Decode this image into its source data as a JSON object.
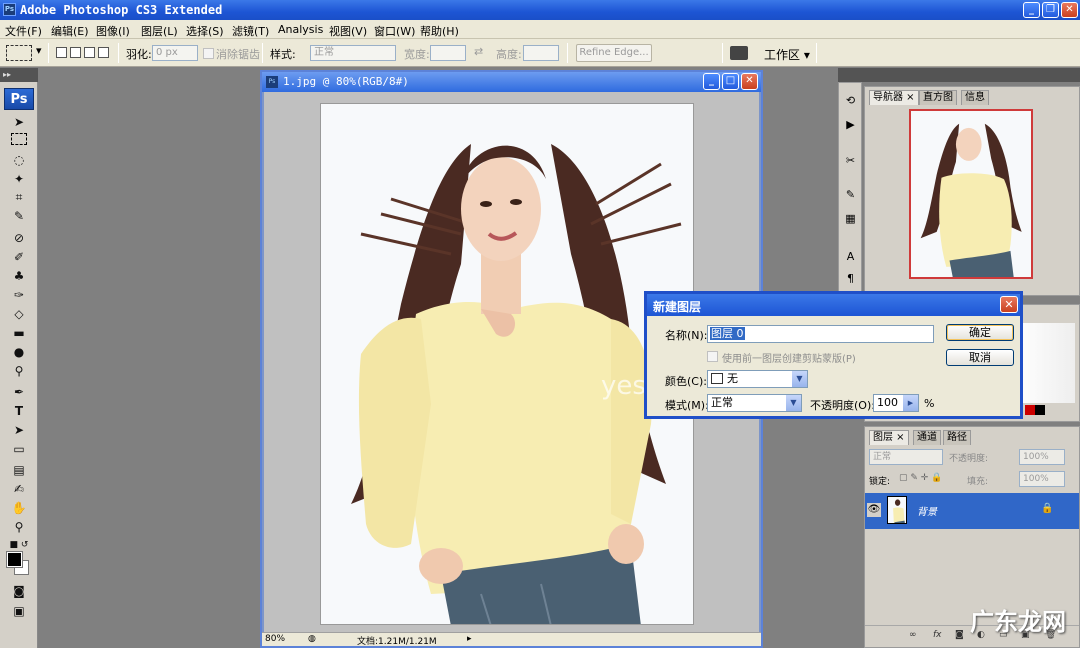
{
  "window": {
    "title": "Adobe Photoshop CS3 Extended",
    "min": "_",
    "restore": "❐",
    "close": "✕"
  },
  "menu": [
    "文件(F)",
    "编辑(E)",
    "图像(I)",
    "图层(L)",
    "选择(S)",
    "滤镜(T)",
    "Analysis",
    "视图(V)",
    "窗口(W)",
    "帮助(H)"
  ],
  "options": {
    "feather_label": "羽化:",
    "feather_value": "0 px",
    "antialias_label": "消除锯齿",
    "style_label": "样式:",
    "style_value": "正常",
    "width_label": "宽度:",
    "height_label": "高度:",
    "refine_edge": "Refine Edge...",
    "workspace": "工作区 ▾"
  },
  "document": {
    "title": "1.jpg @ 80%(RGB/8#)",
    "zoom": "80%",
    "docsize": "文档:1.21M/1.21M"
  },
  "navigator": {
    "tabs": [
      "导航器 ×",
      "直方图",
      "信息"
    ]
  },
  "layers": {
    "tabs": [
      "图层 ×",
      "通道",
      "路径"
    ],
    "blend_mode": "正常",
    "opacity_label": "不透明度:",
    "opacity_value": "100%",
    "lock_label": "锁定:",
    "fill_label": "填充:",
    "fill_value": "100%",
    "layer_name": "背景",
    "footer_icons": [
      "链接",
      "fx",
      "蒙版",
      "调整",
      "组",
      "新建",
      "删除"
    ]
  },
  "dialog": {
    "title": "新建图层",
    "name_label": "名称(N):",
    "name_value": "图层 0",
    "clip_label": "使用前一图层创建剪贴蒙版(P)",
    "color_label": "颜色(C):",
    "color_value": "无",
    "mode_label": "模式(M):",
    "mode_value": "正常",
    "opacity_label": "不透明度(O):",
    "opacity_value": "100",
    "opacity_unit": "%",
    "ok": "确定",
    "cancel": "取消"
  },
  "watermark": "广东龙网",
  "canvas_watermark": "yesky 天极网"
}
